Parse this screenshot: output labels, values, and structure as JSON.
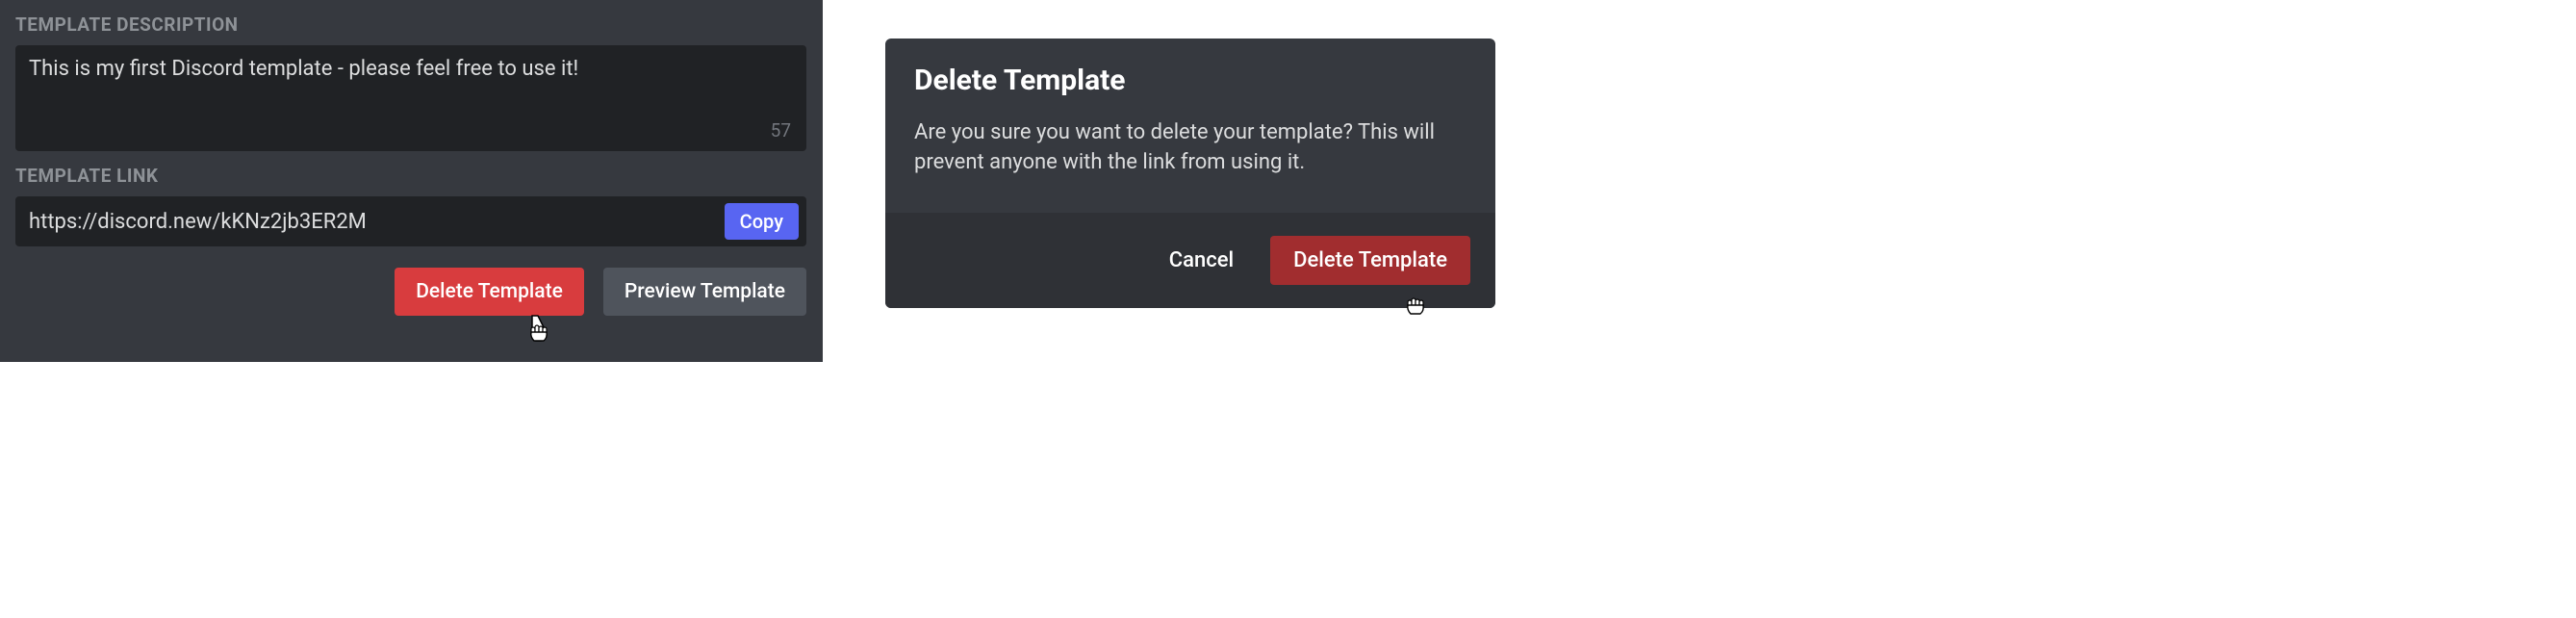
{
  "template_settings": {
    "description_label": "TEMPLATE DESCRIPTION",
    "description_value": "This is my first Discord template - please feel free to use it!",
    "char_count": "57",
    "link_label": "TEMPLATE LINK",
    "link_value": "https://discord.new/kKNz2jb3ER2M",
    "copy_label": "Copy",
    "delete_label": "Delete Template",
    "preview_label": "Preview Template"
  },
  "delete_modal": {
    "title": "Delete Template",
    "body": "Are you sure you want to delete your template? This will prevent anyone with the link from using it.",
    "cancel_label": "Cancel",
    "confirm_label": "Delete Template"
  }
}
